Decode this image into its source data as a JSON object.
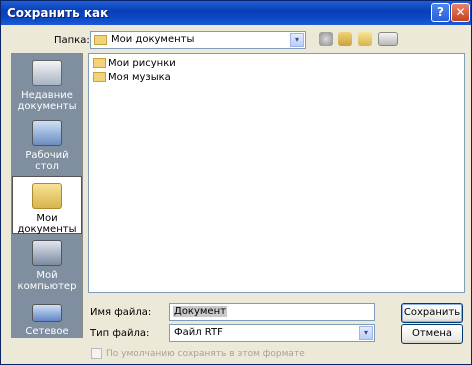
{
  "window": {
    "title": "Сохранить как",
    "help_btn": "?",
    "close_btn": "✕"
  },
  "folder": {
    "label": "Папка:",
    "current": "Мои документы",
    "arrow": "▾"
  },
  "toolbar": {
    "icons": [
      "back-icon",
      "up-folder-icon",
      "new-folder-icon",
      "views-menu-icon"
    ]
  },
  "places": [
    {
      "label": "Недавние документы",
      "icon": "recent-documents-icon"
    },
    {
      "label": "Рабочий стол",
      "icon": "desktop-icon"
    },
    {
      "label": "Мои документы",
      "icon": "my-documents-icon",
      "selected": true
    },
    {
      "label": "Мой компьютер",
      "icon": "my-computer-icon"
    },
    {
      "label": "Сетевое",
      "icon": "network-icon"
    }
  ],
  "files": [
    {
      "name": "Мои рисунки",
      "icon": "folder-icon"
    },
    {
      "name": "Моя музыка",
      "icon": "folder-icon"
    }
  ],
  "filename": {
    "label": "Имя файла:",
    "value": "Документ"
  },
  "filetype": {
    "label": "Тип файла:",
    "value": "Файл RTF"
  },
  "buttons": {
    "save": "Сохранить",
    "cancel": "Отмена"
  },
  "default_format": {
    "label": "По умолчанию сохранять в этом формате",
    "checked": false
  },
  "colors": {
    "titlebar": "#0a3fb5",
    "places_bg": "#7f8f9f"
  }
}
